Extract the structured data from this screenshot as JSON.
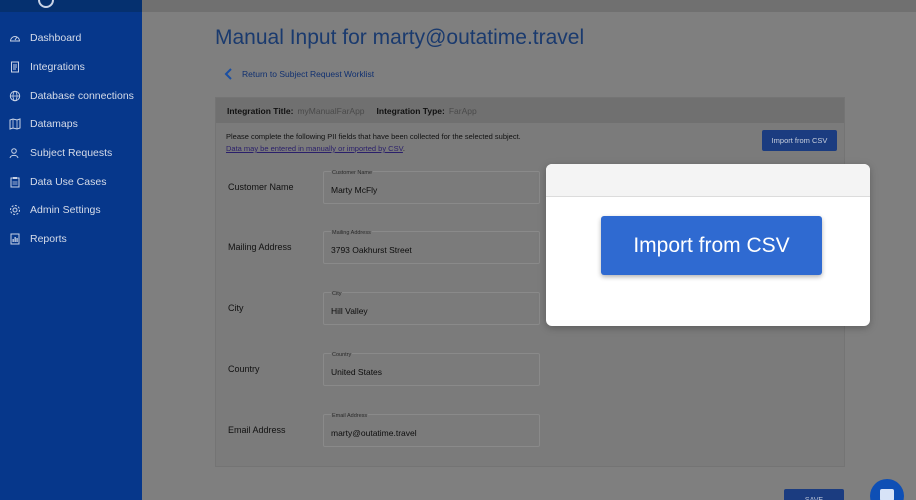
{
  "sidebar": {
    "items": [
      {
        "label": "Dashboard",
        "icon": "gauge-icon"
      },
      {
        "label": "Integrations",
        "icon": "document-icon"
      },
      {
        "label": "Database connections",
        "icon": "globe-icon"
      },
      {
        "label": "Datamaps",
        "icon": "map-icon"
      },
      {
        "label": "Subject Requests",
        "icon": "person-icon"
      },
      {
        "label": "Data Use Cases",
        "icon": "clipboard-icon"
      },
      {
        "label": "Admin Settings",
        "icon": "gear-icon"
      },
      {
        "label": "Reports",
        "icon": "report-icon"
      }
    ]
  },
  "main": {
    "title": "Manual Input for marty@outatime.travel",
    "back_link": "Return to Subject Request Worklist",
    "integration_title_label": "Integration Title:",
    "integration_title_value": "myManualFarApp",
    "integration_type_label": "Integration Type:",
    "integration_type_value": "FarApp",
    "instructions_line1": "Please complete the following PII fields that have been collected for the selected subject.",
    "instructions_link": "Data may be entered in manually or imported by CSV",
    "instructions_period": ".",
    "import_button": "Import from CSV",
    "fields": [
      {
        "label": "Customer Name",
        "legend": "Customer Name",
        "value": "Marty McFly"
      },
      {
        "label": "Mailing Address",
        "legend": "Mailing Address",
        "value": "3793 Oakhurst Street"
      },
      {
        "label": "City",
        "legend": "City",
        "value": "Hill Valley"
      },
      {
        "label": "Country",
        "legend": "Country",
        "value": "United States"
      },
      {
        "label": "Email Address",
        "legend": "Email Address",
        "value": "marty@outatime.travel"
      }
    ],
    "save_button": "SAVE"
  },
  "highlight": {
    "button_label": "Import from CSV"
  },
  "colors": {
    "sidebar": "#06378b",
    "accent": "#2f6ad1",
    "button_dark": "#1b3c80"
  }
}
